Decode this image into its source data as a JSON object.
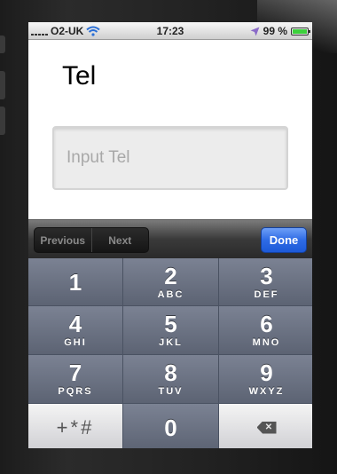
{
  "statusbar": {
    "carrier": "O2-UK",
    "time": "17:23",
    "battery_text": "99 %",
    "battery_level": 0.99
  },
  "page": {
    "title": "Tel",
    "input_placeholder": "Input Tel",
    "input_value": ""
  },
  "toolbar": {
    "previous_label": "Previous",
    "next_label": "Next",
    "done_label": "Done"
  },
  "keypad": {
    "keys": [
      {
        "num": "1",
        "letters": ""
      },
      {
        "num": "2",
        "letters": "ABC"
      },
      {
        "num": "3",
        "letters": "DEF"
      },
      {
        "num": "4",
        "letters": "GHI"
      },
      {
        "num": "5",
        "letters": "JKL"
      },
      {
        "num": "6",
        "letters": "MNO"
      },
      {
        "num": "7",
        "letters": "PQRS"
      },
      {
        "num": "8",
        "letters": "TUV"
      },
      {
        "num": "9",
        "letters": "WXYZ"
      },
      {
        "num": "+*#",
        "letters": ""
      },
      {
        "num": "0",
        "letters": ""
      },
      {
        "num": "",
        "letters": ""
      }
    ]
  },
  "icons": {
    "wifi": "wifi-icon",
    "location": "location-arrow-icon",
    "battery": "battery-icon",
    "delete": "backspace-icon"
  },
  "colors": {
    "done_button": "#2e6be5",
    "keypad_key": "#6a7182",
    "battery_fill": "#3bd13b"
  }
}
